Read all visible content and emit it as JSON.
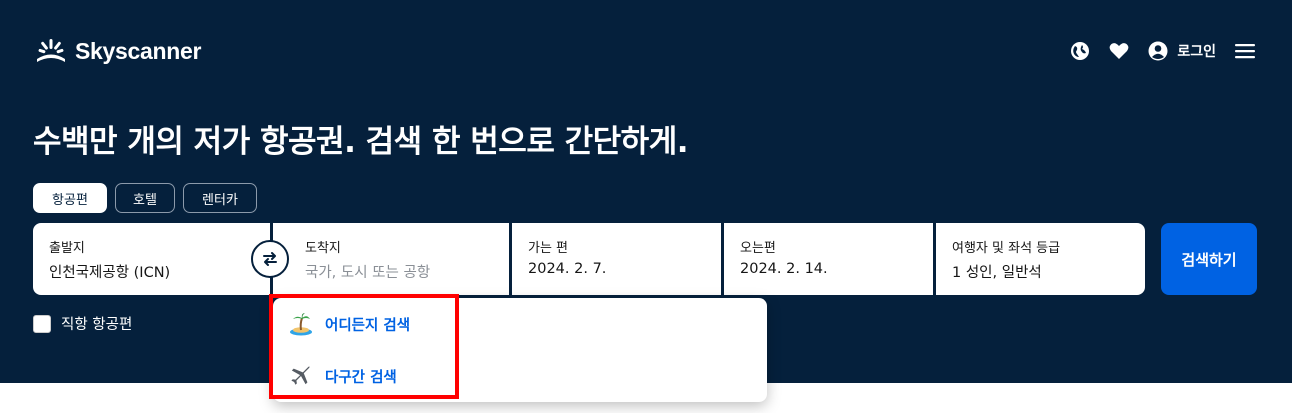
{
  "brand": {
    "name": "Skyscanner"
  },
  "nav": {
    "login_label": "로그인",
    "icons": [
      "globe-icon",
      "heart-icon",
      "account-icon",
      "menu-icon"
    ]
  },
  "hero": {
    "headline": "수백만 개의 저가 항공권. 검색 한 번으로 간단하게."
  },
  "tabs": [
    {
      "label": "항공편",
      "active": true
    },
    {
      "label": "호텔",
      "active": false
    },
    {
      "label": "렌터카",
      "active": false
    }
  ],
  "search": {
    "origin": {
      "label": "출발지",
      "value": "인천국제공항 (ICN)"
    },
    "destination": {
      "label": "도착지",
      "placeholder": "국가, 도시 또는 공항"
    },
    "depart": {
      "label": "가는 편",
      "value": "2024. 2. 7."
    },
    "return": {
      "label": "오는편",
      "value": "2024. 2. 14."
    },
    "travellers": {
      "label": "여행자 및 좌석 등급",
      "value": "1 성인, 일반석"
    },
    "button_label": "검색하기"
  },
  "direct_flights": {
    "label": "직항 항공편",
    "checked": false
  },
  "dropdown": {
    "items": [
      {
        "label": "어디든지 검색",
        "icon": "island-icon"
      },
      {
        "label": "다구간 검색",
        "icon": "airplane-icon"
      }
    ]
  },
  "colors": {
    "background": "#05203c",
    "accent": "#0062e3",
    "highlight": "#ff0000"
  }
}
